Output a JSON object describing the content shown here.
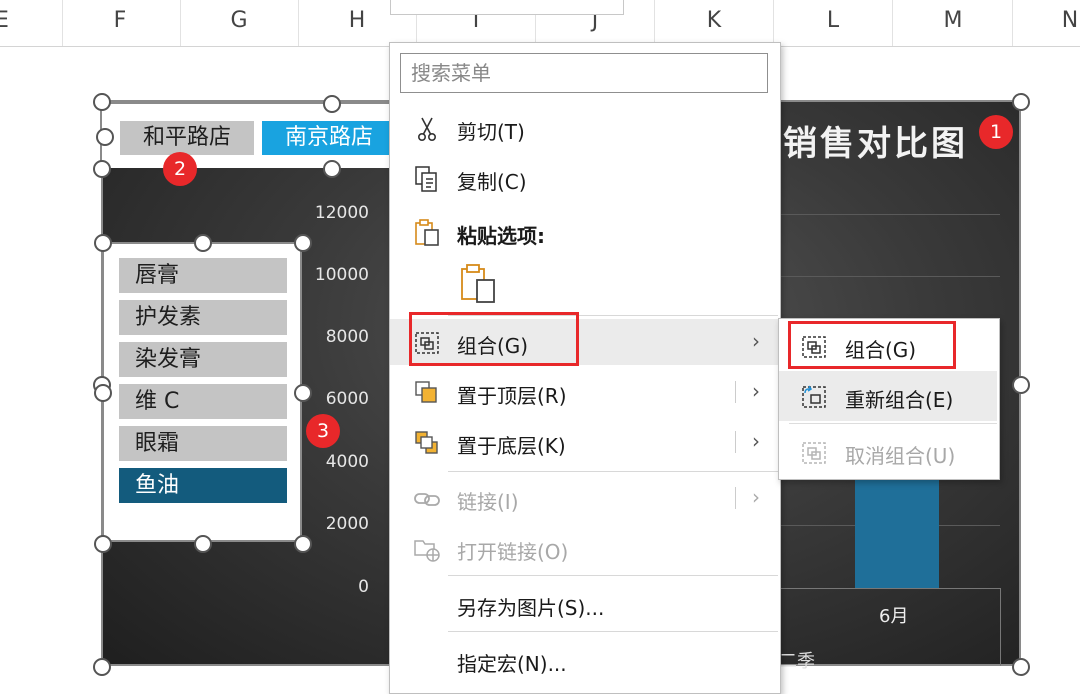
{
  "column_headers": [
    "E",
    "F",
    "G",
    "H",
    "I",
    "J",
    "K",
    "L",
    "M",
    "N"
  ],
  "chart": {
    "title": "销售对比图",
    "y_ticks": [
      "12000",
      "10000",
      "8000",
      "6000",
      "4000",
      "2000",
      "0"
    ],
    "x_label": "6月",
    "x_group_label": "二季",
    "bar_color": "#1f6f99"
  },
  "chart_data": {
    "type": "bar",
    "title": "销售对比图",
    "categories": [
      "6月"
    ],
    "values": [
      3800
    ],
    "ylim": [
      0,
      12000
    ],
    "grid": true
  },
  "store_slicer": {
    "items": [
      {
        "label": "和平路店",
        "selected": false
      },
      {
        "label": "南京路店",
        "selected": true
      }
    ]
  },
  "product_slicer": {
    "items": [
      {
        "label": "唇膏",
        "selected": false
      },
      {
        "label": "护发素",
        "selected": false
      },
      {
        "label": "染发膏",
        "selected": false
      },
      {
        "label": "维 C",
        "selected": false
      },
      {
        "label": "眼霜",
        "selected": false
      },
      {
        "label": "鱼油",
        "selected": true
      }
    ]
  },
  "badges": [
    "1",
    "2",
    "3"
  ],
  "context_menu": {
    "search_placeholder": "搜索菜单",
    "cut": "剪切(T)",
    "copy": "复制(C)",
    "paste_options": "粘贴选项:",
    "group": "组合(G)",
    "bring_to_front": "置于顶层(R)",
    "send_to_back": "置于底层(K)",
    "link": "链接(I)",
    "open_link": "打开链接(O)",
    "save_as_picture": "另存为图片(S)...",
    "assign_macro": "指定宏(N)..."
  },
  "sub_menu": {
    "group": "组合(G)",
    "regroup": "重新组合(E)",
    "ungroup": "取消组合(U)"
  },
  "colors": {
    "accent_red": "#e8282a",
    "store_selected": "#19a3e0",
    "product_selected": "#135b7d"
  }
}
